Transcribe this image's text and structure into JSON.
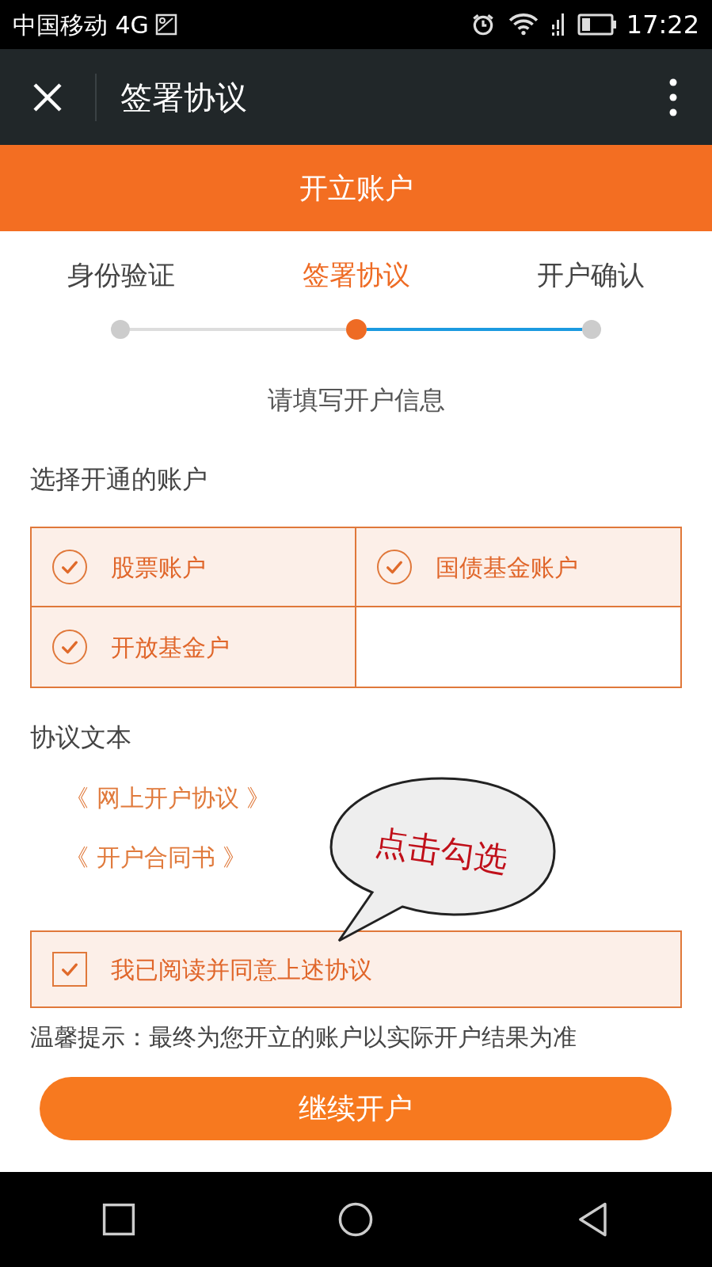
{
  "status_bar": {
    "carrier": "中国移动 4G",
    "time": "17:22"
  },
  "title_bar": {
    "title": "签署协议"
  },
  "header": {
    "title": "开立账户"
  },
  "steps": [
    {
      "label": "身份验证",
      "selected": false
    },
    {
      "label": "签署协议",
      "selected": true
    },
    {
      "label": "开户确认",
      "selected": false
    }
  ],
  "connectors": [
    {
      "active": false
    },
    {
      "active": true
    }
  ],
  "subtitle": "请填写开户信息",
  "accounts": {
    "label": "选择开通的账户",
    "items": [
      {
        "label": "股票账户",
        "checked": true
      },
      {
        "label": "国债基金账户",
        "checked": true
      },
      {
        "label": "开放基金户",
        "checked": true
      }
    ]
  },
  "agreements": {
    "label": "协议文本",
    "links": [
      "《 网上开户协议 》",
      "《 开户合同书 》"
    ]
  },
  "callout": "点击勾选",
  "agree": {
    "label": "我已阅读并同意上述协议",
    "checked": true
  },
  "tip": "温馨提示：最终为您开立的账户以实际开户结果为准",
  "continue_button": "继续开户"
}
